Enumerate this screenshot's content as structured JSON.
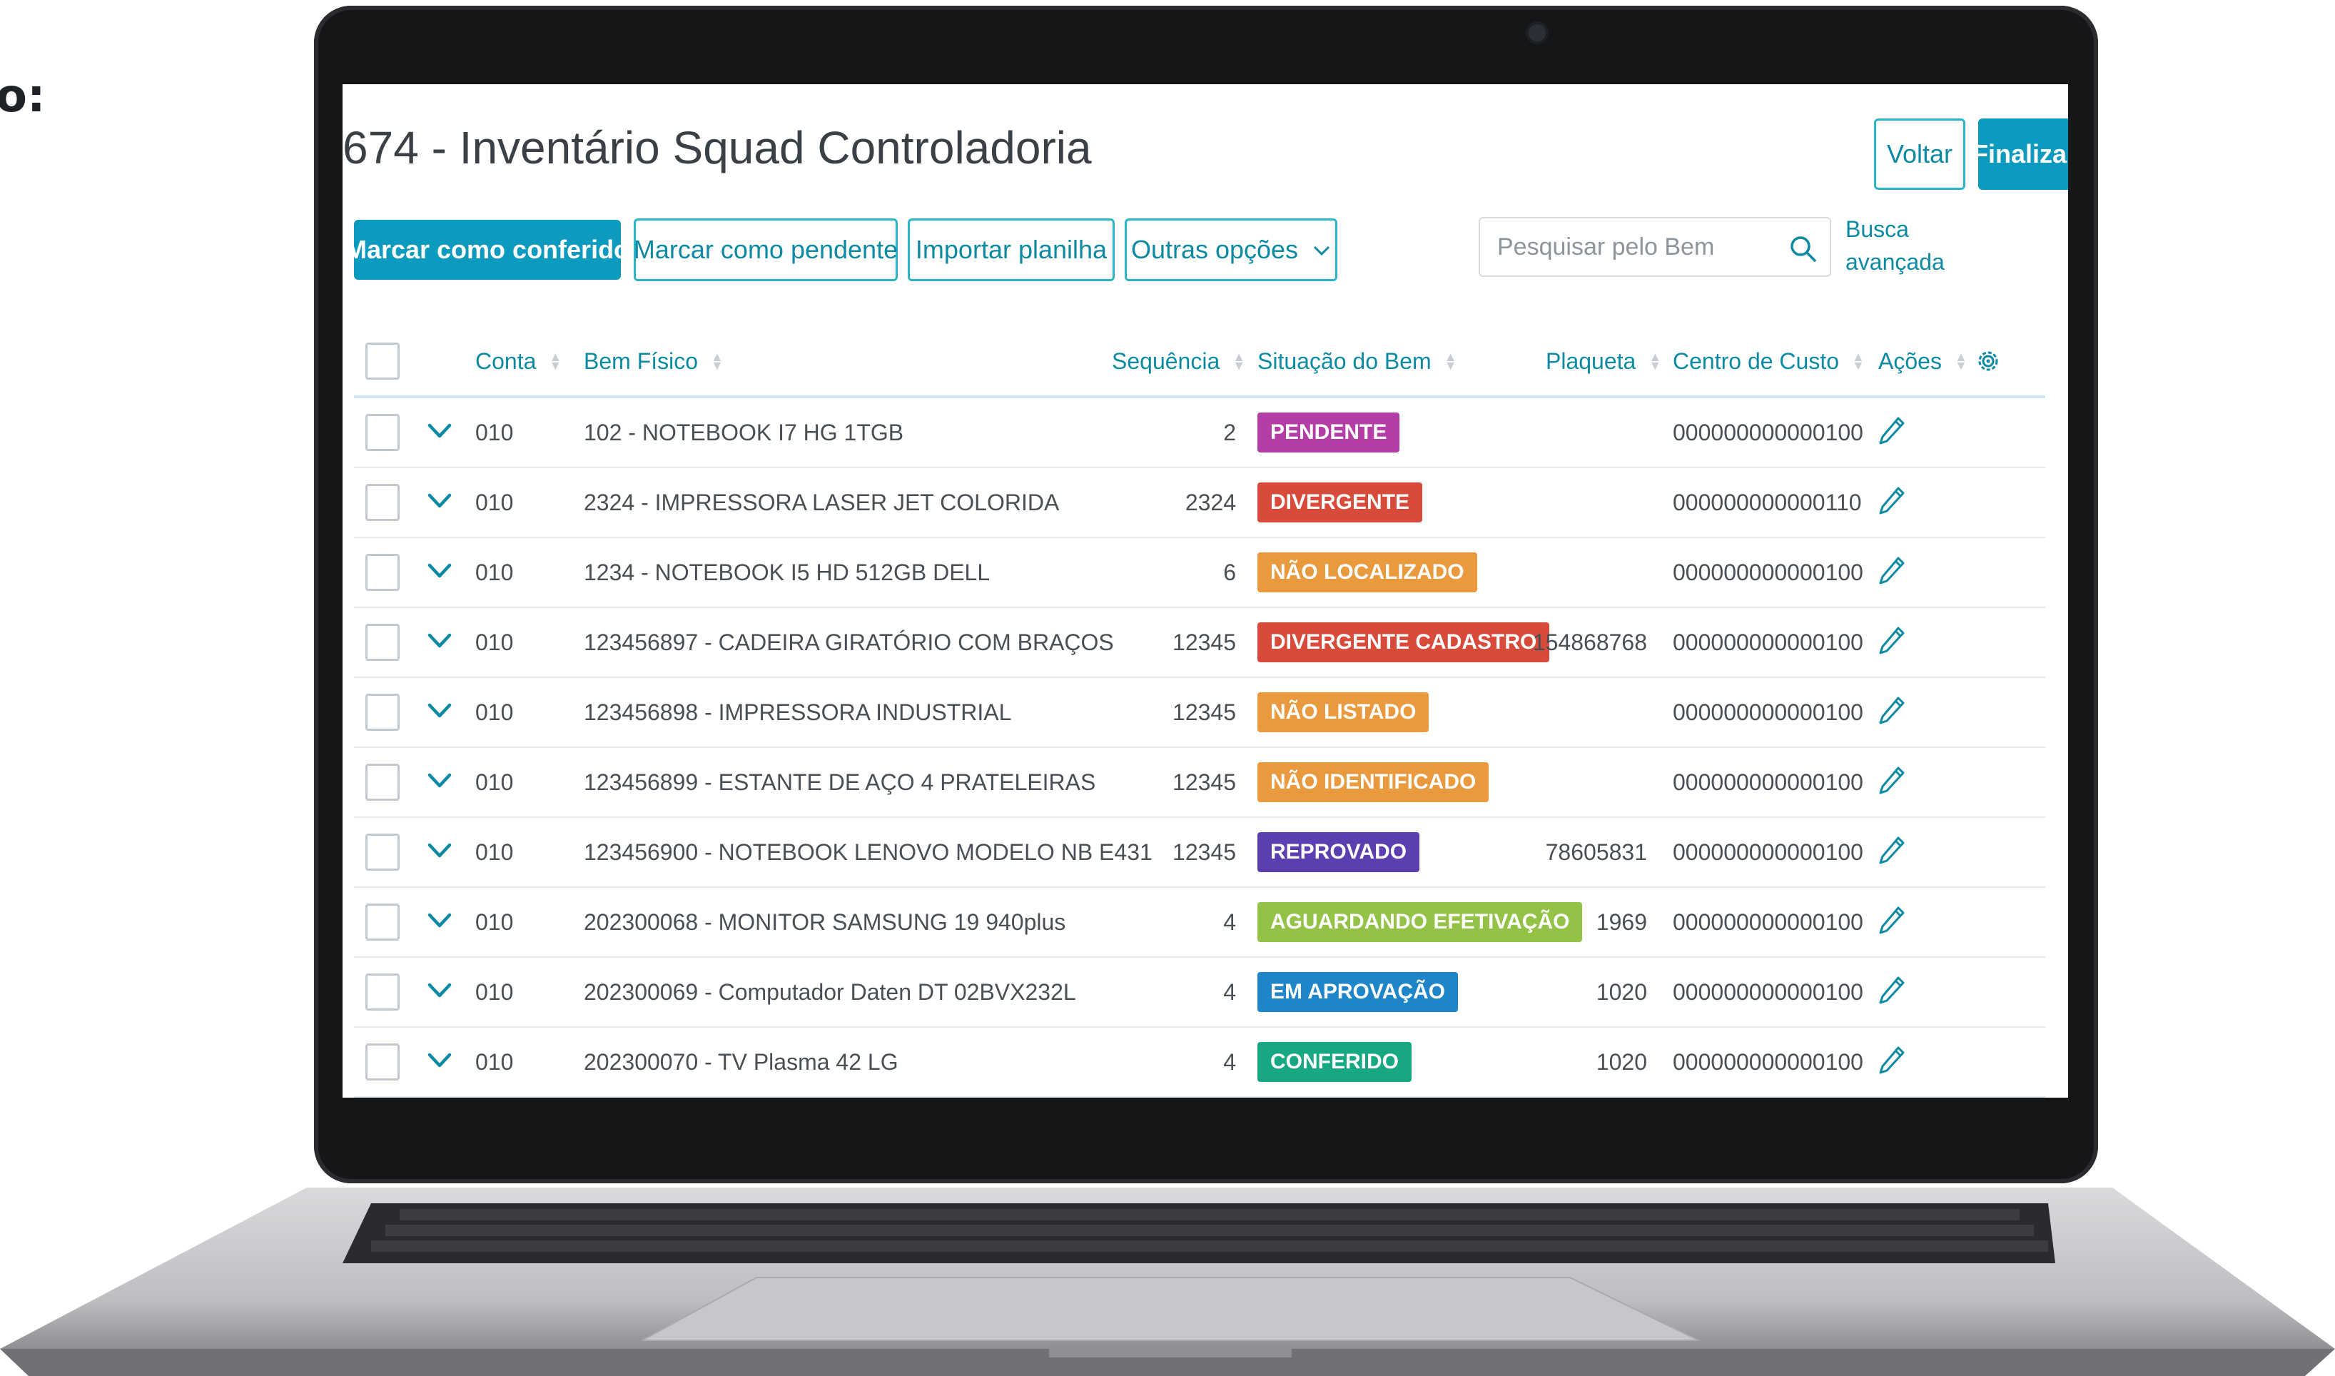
{
  "caption": "o:",
  "page": {
    "title": "674 - Inventário Squad Controladoria"
  },
  "header_actions": {
    "back_label": "Voltar",
    "finish_label": "Finalizar inventário"
  },
  "toolbar": {
    "mark_checked": "Marcar como conferido",
    "mark_pending": "Marcar como pendente",
    "import_sheet": "Importar planilha",
    "other_options": "Outras opções",
    "search_placeholder": "Pesquisar pelo Bem",
    "advanced_search": "Busca avançada"
  },
  "table": {
    "columns": {
      "account": "Conta",
      "asset": "Bem Físico",
      "sequence": "Sequência",
      "status": "Situação do Bem",
      "tag": "Plaqueta",
      "cost_center": "Centro de Custo",
      "actions": "Ações"
    },
    "rows": [
      {
        "account": "010",
        "asset": "102 - NOTEBOOK I7 HG 1TGB",
        "sequence": "2",
        "status": "PENDENTE",
        "status_color": "#b33fa6",
        "tag": "",
        "cost_center": "000000000000100"
      },
      {
        "account": "010",
        "asset": "2324 - IMPRESSORA LASER JET COLORIDA",
        "sequence": "2324",
        "status": "DIVERGENTE",
        "status_color": "#d84a3a",
        "tag": "",
        "cost_center": "000000000000110"
      },
      {
        "account": "010",
        "asset": "1234 - NOTEBOOK I5 HD 512GB DELL",
        "sequence": "6",
        "status": "NÃO LOCALIZADO",
        "status_color": "#ea9a3e",
        "tag": "",
        "cost_center": "000000000000100"
      },
      {
        "account": "010",
        "asset": "123456897 - CADEIRA GIRATÓRIO COM BRAÇOS",
        "sequence": "12345",
        "status": "DIVERGENTE CADASTRO",
        "status_color": "#d84a3a",
        "tag": "154868768",
        "cost_center": "000000000000100"
      },
      {
        "account": "010",
        "asset": "123456898 - IMPRESSORA INDUSTRIAL",
        "sequence": "12345",
        "status": "NÃO LISTADO",
        "status_color": "#ea9a3e",
        "tag": "",
        "cost_center": "000000000000100"
      },
      {
        "account": "010",
        "asset": "123456899 - ESTANTE DE AÇO 4 PRATELEIRAS",
        "sequence": "12345",
        "status": "NÃO IDENTIFICADO",
        "status_color": "#ea9a3e",
        "tag": "",
        "cost_center": "000000000000100"
      },
      {
        "account": "010",
        "asset": "123456900 - NOTEBOOK LENOVO MODELO NB E431",
        "sequence": "12345",
        "status": "REPROVADO",
        "status_color": "#5b3fb0",
        "tag": "78605831",
        "cost_center": "000000000000100"
      },
      {
        "account": "010",
        "asset": "202300068 - MONITOR SAMSUNG 19 940plus",
        "sequence": "4",
        "status": "AGUARDANDO EFETIVAÇÃO",
        "status_color": "#93c247",
        "tag": "1969",
        "cost_center": "000000000000100"
      },
      {
        "account": "010",
        "asset": "202300069 - Computador Daten DT 02BVX232L",
        "sequence": "4",
        "status": "EM APROVAÇÃO",
        "status_color": "#1e86c8",
        "tag": "1020",
        "cost_center": "000000000000100"
      },
      {
        "account": "010",
        "asset": "202300070 - TV Plasma 42 LG",
        "sequence": "4",
        "status": "CONFERIDO",
        "status_color": "#17a883",
        "tag": "1020",
        "cost_center": "000000000000100"
      }
    ]
  },
  "colors": {
    "accent": "#0c9abe",
    "link": "#0c8aa4"
  },
  "icons": {
    "search": "search-icon",
    "expand": "chevron-down-icon",
    "edit": "pencil-icon",
    "settings": "gear-icon",
    "dropdown": "chevron-down-icon"
  }
}
